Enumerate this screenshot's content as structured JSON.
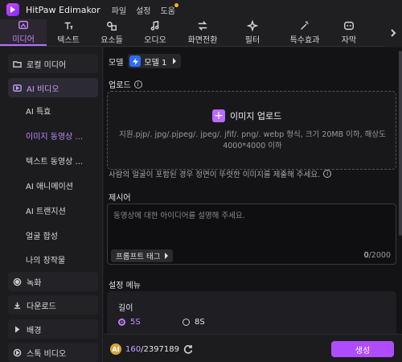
{
  "app": {
    "name": "HitPaw Edimakor",
    "menu": [
      "파일",
      "설정",
      "도움"
    ]
  },
  "toolbar": {
    "tools": [
      {
        "label": "미디어",
        "icon": "media-icon"
      },
      {
        "label": "텍스트",
        "icon": "text-icon"
      },
      {
        "label": "요소들",
        "icon": "elements-icon"
      },
      {
        "label": "오디오",
        "icon": "audio-icon"
      },
      {
        "label": "화면전환",
        "icon": "transition-icon"
      },
      {
        "label": "필터",
        "icon": "filter-icon"
      },
      {
        "label": "특수효과",
        "icon": "effects-icon"
      },
      {
        "label": "자막",
        "icon": "subtitle-icon"
      }
    ]
  },
  "sidebar": {
    "local_media": "로컬 미디어",
    "ai_video": "AI 비디오",
    "ai_items": [
      "AI 특효",
      "이미지 동영상 ...",
      "텍스트 동영상 ...",
      "AI 애니메이션",
      "AI 트랜지션",
      "얼굴 합성",
      "나의 창작물"
    ],
    "record": "녹화",
    "download": "다운로드",
    "background": "배경",
    "stock_video": "스톡 비디오"
  },
  "main": {
    "model_label": "모델",
    "model_name": "모델 1",
    "upload_label": "업로드",
    "upload_button": "이미지 업로드",
    "upload_note": "지원.pjp/. jpg/.pjpeg/. jpeg/. jfif/. png/. webp 형식, 크기 20MB 이하, 해상도 4000*4000 이하",
    "face_hint": "사람의 얼굴이 포함된 경우 정면이 뚜렷한 이미지를 제출해 주세요.",
    "prompt_label": "제시어",
    "prompt_placeholder": "동영상에 대한 아이디어를 설명해 주세요.",
    "prompt_tag": "프롬프트 태그",
    "char_count": "0",
    "char_limit": "/2000",
    "settings_title": "설정 메뉴",
    "length_label": "길이",
    "length_options": [
      "5S",
      "8S"
    ],
    "length_selected": "5S"
  },
  "bottom": {
    "credits_used": "160",
    "credits_total": "/2397189",
    "generate": "생성"
  },
  "colors": {
    "accent": "#b04cff",
    "accent_text": "#c7a1ff",
    "bg": "#131316"
  }
}
